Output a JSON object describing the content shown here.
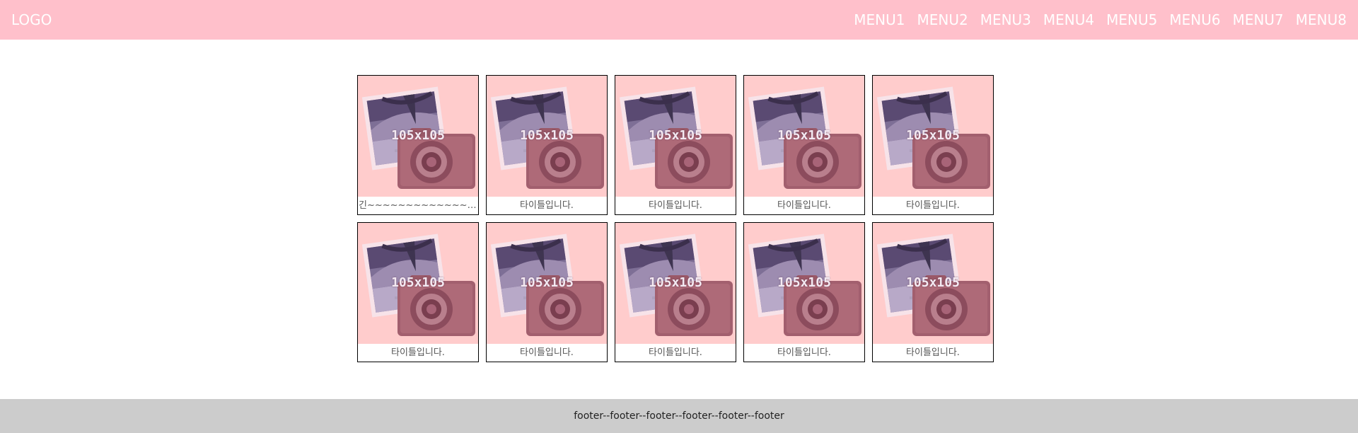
{
  "header": {
    "logo": "LOGO",
    "menu": [
      "MENU1",
      "MENU2",
      "MENU3",
      "MENU4",
      "MENU5",
      "MENU6",
      "MENU7",
      "MENU8"
    ]
  },
  "gallery": {
    "placeholder_text": "105x105",
    "placeholder_icon": "photo-camera-icon",
    "items": [
      {
        "caption": "긴~~~~~~~~~~~~~~~~~~~~~~~~~~~~~~~~~~~~~~~~~~~~~"
      },
      {
        "caption": "타이틀입니다."
      },
      {
        "caption": "타이틀입니다."
      },
      {
        "caption": "타이틀입니다."
      },
      {
        "caption": "타이틀입니다."
      },
      {
        "caption": "타이틀입니다."
      },
      {
        "caption": "타이틀입니다."
      },
      {
        "caption": "타이틀입니다."
      },
      {
        "caption": "타이틀입니다."
      },
      {
        "caption": "타이틀입니다."
      }
    ]
  },
  "footer": {
    "text": "footer--footer--footer--footer--footer--footer"
  },
  "colors": {
    "header_bg": "#ffc0cb",
    "thumb_bg": "#ffcccc",
    "footer_bg": "#cccccc"
  }
}
